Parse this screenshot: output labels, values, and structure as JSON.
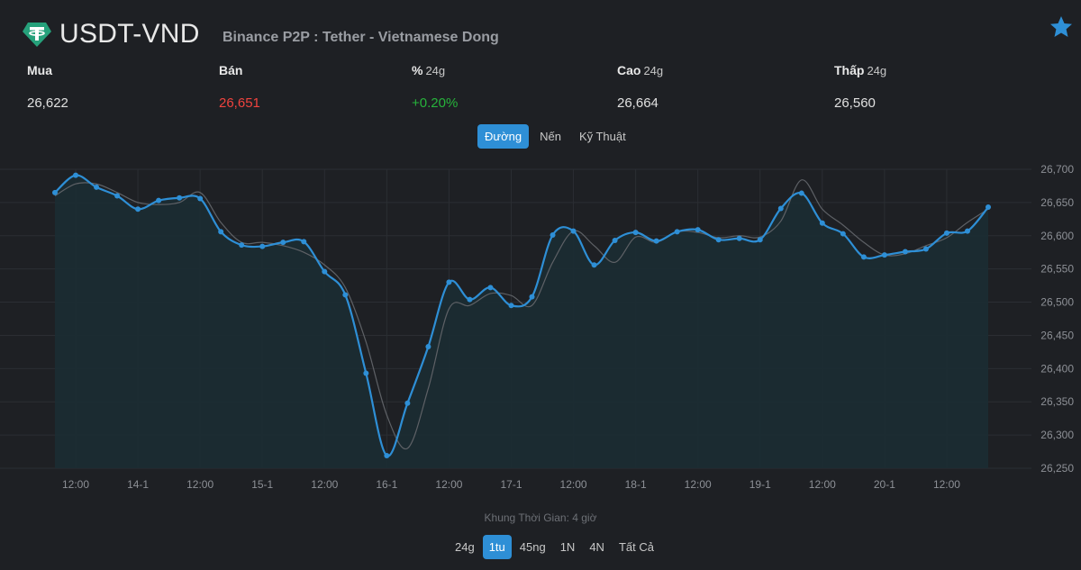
{
  "header": {
    "pair": "USDT-VND",
    "subtitle": "Binance P2P : Tether - Vietnamese Dong",
    "logo_icon": "tether-icon",
    "favorite_icon": "star-icon",
    "brand_color": "#26a17b",
    "star_color": "#2e8fd6"
  },
  "stats": {
    "buy": {
      "label": "Mua",
      "value": "26,622"
    },
    "sell": {
      "label": "Bán",
      "value": "26,651",
      "color": "#f0433e"
    },
    "change": {
      "label": "%",
      "suffix": "24g",
      "value": "+0.20%",
      "color": "#27b33b"
    },
    "high": {
      "label": "Cao",
      "suffix": "24g",
      "value": "26,664"
    },
    "low": {
      "label": "Thấp",
      "suffix": "24g",
      "value": "26,560"
    }
  },
  "chart_tabs": [
    {
      "label": "Đường",
      "active": true
    },
    {
      "label": "Nến",
      "active": false
    },
    {
      "label": "Kỹ Thuật",
      "active": false
    }
  ],
  "timeframe_label": "Khung Thời Gian: 4 giờ",
  "ranges": [
    {
      "label": "24g",
      "active": false
    },
    {
      "label": "1tu",
      "active": true
    },
    {
      "label": "45ng",
      "active": false
    },
    {
      "label": "1N",
      "active": false
    },
    {
      "label": "4N",
      "active": false
    },
    {
      "label": "Tất Cả",
      "active": false
    }
  ],
  "chart_data": {
    "type": "area",
    "x": [
      "13-1 08:00",
      "13-1 12:00",
      "13-1 16:00",
      "13-1 20:00",
      "14-1 00:00",
      "14-1 04:00",
      "14-1 08:00",
      "14-1 12:00",
      "14-1 16:00",
      "14-1 20:00",
      "15-1 00:00",
      "15-1 04:00",
      "15-1 08:00",
      "15-1 12:00",
      "15-1 16:00",
      "15-1 20:00",
      "16-1 00:00",
      "16-1 04:00",
      "16-1 08:00",
      "16-1 12:00",
      "16-1 16:00",
      "16-1 20:00",
      "17-1 00:00",
      "17-1 04:00",
      "17-1 08:00",
      "17-1 12:00",
      "17-1 16:00",
      "17-1 20:00",
      "18-1 00:00",
      "18-1 04:00",
      "18-1 08:00",
      "18-1 12:00",
      "18-1 16:00",
      "18-1 20:00",
      "19-1 00:00",
      "19-1 04:00",
      "19-1 08:00",
      "19-1 12:00",
      "19-1 16:00",
      "19-1 20:00",
      "20-1 00:00",
      "20-1 04:00",
      "20-1 08:00",
      "20-1 12:00",
      "20-1 16:00"
    ],
    "series": [
      {
        "values": [
          26665,
          26691,
          26673,
          26660,
          26640,
          26653,
          26657,
          26656,
          26606,
          26586,
          26584,
          26590,
          26591,
          26546,
          26511,
          26393,
          26269,
          26348,
          26433,
          26530,
          26504,
          26522,
          26495,
          26508,
          26601,
          26607,
          26556,
          26593,
          26605,
          26592,
          26606,
          26609,
          26594,
          26596,
          26594,
          26641,
          26664,
          26619,
          26603,
          26568,
          26571,
          26576,
          26580,
          26604,
          26607,
          26643
        ],
        "color": "#2e8fd6"
      },
      {
        "values": [
          26660,
          26678,
          26678,
          26665,
          26650,
          26647,
          26650,
          26665,
          26620,
          26590,
          26590,
          26585,
          26575,
          26556,
          26522,
          26440,
          26330,
          26280,
          26370,
          26490,
          26495,
          26513,
          26510,
          26495,
          26560,
          26607,
          26585,
          26560,
          26598,
          26590,
          26606,
          26605,
          26597,
          26600,
          26598,
          26622,
          26684,
          26640,
          26616,
          26590,
          26571,
          26573,
          26585,
          26597,
          26620,
          26640
        ],
        "color": "#5e6166"
      }
    ],
    "x_tick_labels": [
      "12:00",
      "14-1",
      "12:00",
      "15-1",
      "12:00",
      "16-1",
      "12:00",
      "17-1",
      "12:00",
      "18-1",
      "12:00",
      "19-1",
      "12:00",
      "20-1",
      "12:00"
    ],
    "y_tick_labels": [
      "26,700",
      "26,650",
      "26,600",
      "26,550",
      "26,500",
      "26,450",
      "26,400",
      "26,350",
      "26,300",
      "26,250"
    ],
    "ylim": [
      26250,
      26700
    ],
    "grid": true,
    "fill_color": "#1b2c33"
  }
}
